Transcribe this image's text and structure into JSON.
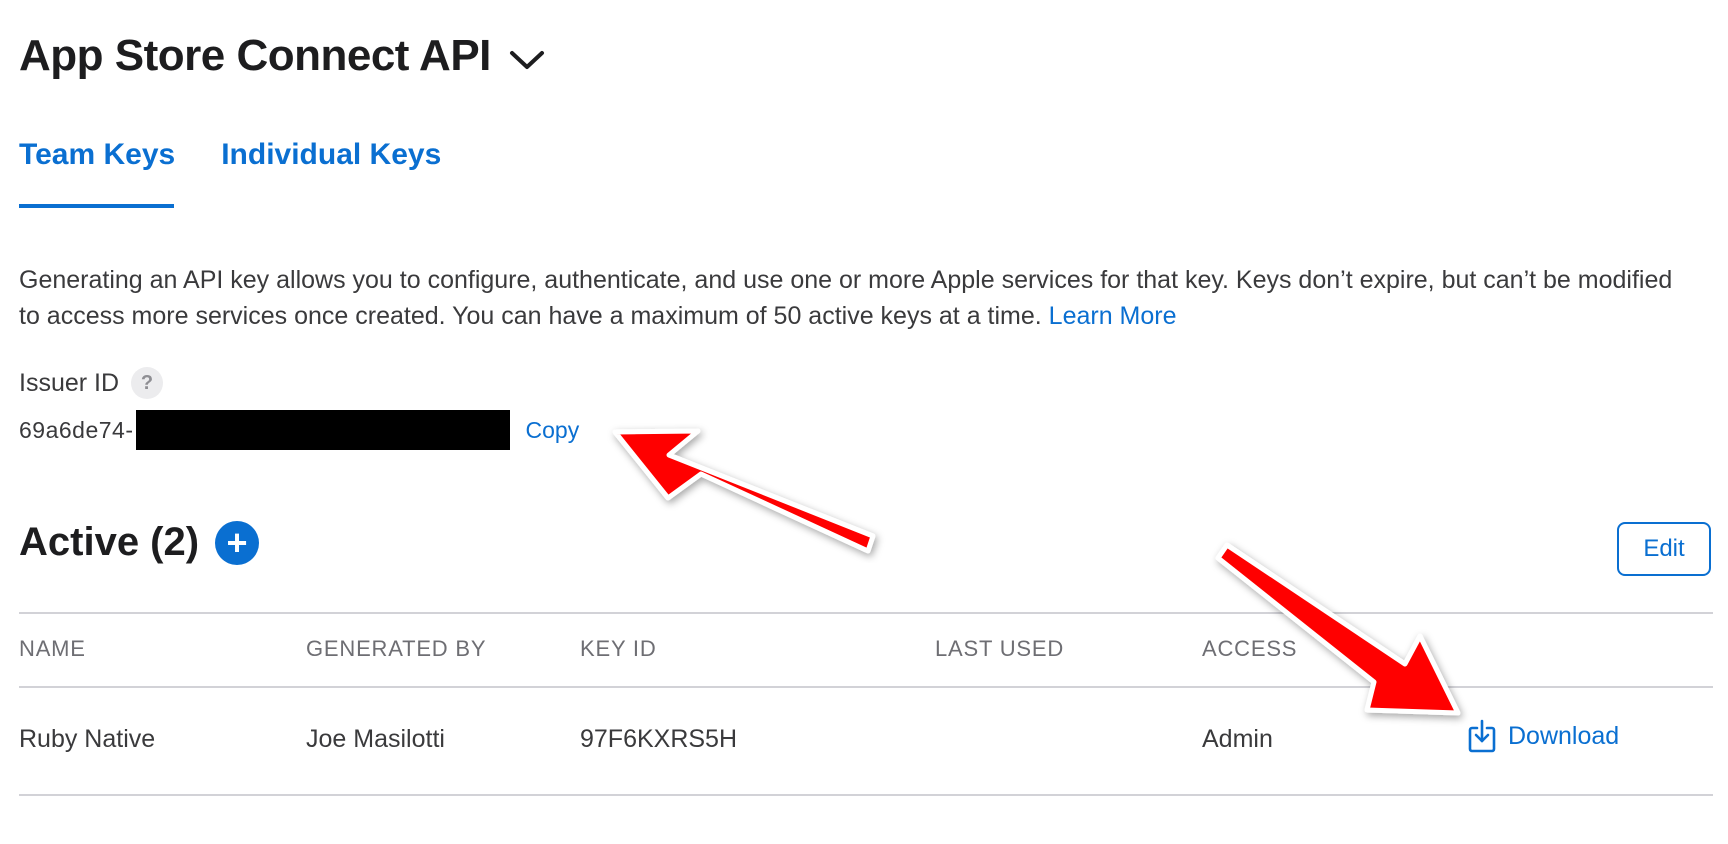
{
  "header": {
    "title": "App Store Connect API"
  },
  "tabs": [
    {
      "label": "Team Keys",
      "active": true
    },
    {
      "label": "Individual Keys",
      "active": false
    }
  ],
  "description": {
    "text": "Generating an API key allows you to configure, authenticate, and use one or more Apple services for that key. Keys don’t expire, but can’t be modified to access more services once created. You can have a maximum of 50 active keys at a time.",
    "learn_more": "Learn More"
  },
  "issuer": {
    "label": "Issuer ID",
    "help_glyph": "?",
    "value_prefix": "69a6de74-",
    "copy_label": "Copy"
  },
  "active": {
    "title": "Active (2)",
    "add_glyph": "+",
    "edit_label": "Edit"
  },
  "table": {
    "columns": [
      "NAME",
      "GENERATED BY",
      "KEY ID",
      "LAST USED",
      "ACCESS"
    ],
    "rows": [
      {
        "name": "Ruby Native",
        "generated_by": "Joe Masilotti",
        "key_id": "97F6KXRS5H",
        "last_used": "",
        "access": "Admin",
        "action": "Download"
      }
    ]
  },
  "colors": {
    "accent": "#0a6fd1",
    "annotation_arrow": "#ff0000",
    "text": "#1d1d1f"
  },
  "icons": [
    "chevron-down-icon",
    "question-icon",
    "plus-icon",
    "download-icon",
    "arrow-annotation"
  ]
}
